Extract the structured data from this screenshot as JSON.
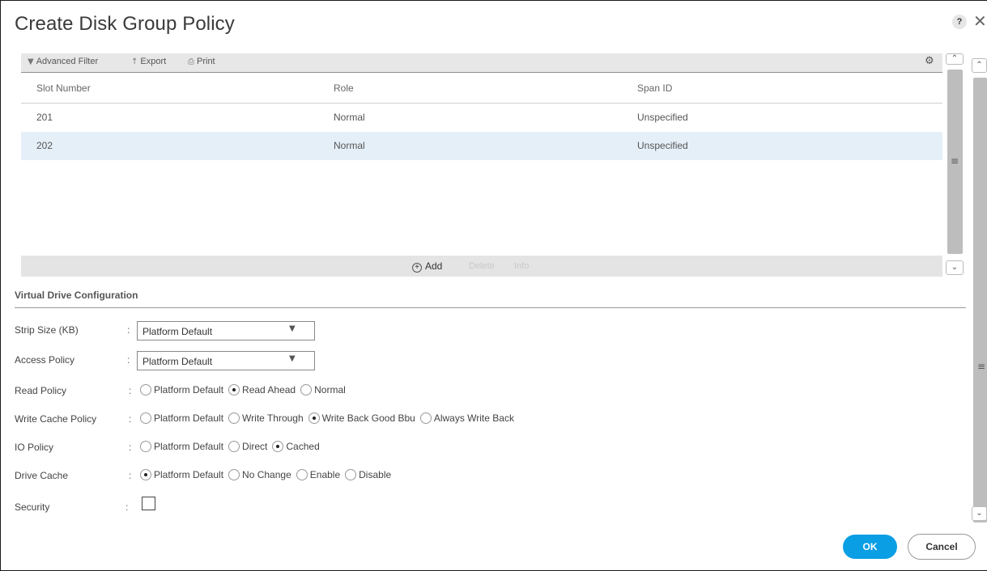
{
  "dialog": {
    "title": "Create Disk Group Policy",
    "help_label": "?",
    "close_label": "✕"
  },
  "toolbar": {
    "advanced_filter": "Advanced Filter",
    "export": "Export",
    "print": "Print"
  },
  "table": {
    "columns": [
      "Slot Number",
      "Role",
      "Span ID"
    ],
    "rows": [
      [
        "201",
        "Normal",
        "Unspecified"
      ],
      [
        "202",
        "Normal",
        "Unspecified"
      ]
    ],
    "selected_row": 2
  },
  "table_actions": {
    "add": "Add",
    "delete": "Delete",
    "info": "Info"
  },
  "section": {
    "title": "Virtual Drive Configuration"
  },
  "form": {
    "strip_size": {
      "label": "Strip Size (KB)",
      "value": "Platform Default"
    },
    "access_policy": {
      "label": "Access Policy",
      "value": "Platform Default"
    },
    "read_policy": {
      "label": "Read Policy",
      "options": [
        "Platform Default",
        "Read Ahead",
        "Normal"
      ],
      "selected": "Read Ahead"
    },
    "write_cache_policy": {
      "label": "Write Cache Policy",
      "options": [
        "Platform Default",
        "Write Through",
        "Write Back Good Bbu",
        "Always Write Back"
      ],
      "selected": "Write Back Good Bbu"
    },
    "io_policy": {
      "label": "IO Policy",
      "options": [
        "Platform Default",
        "Direct",
        "Cached"
      ],
      "selected": "Cached"
    },
    "drive_cache": {
      "label": "Drive Cache",
      "options": [
        "Platform Default",
        "No Change",
        "Enable",
        "Disable"
      ],
      "selected": "Platform Default"
    },
    "security": {
      "label": "Security",
      "checked": false
    }
  },
  "buttons": {
    "ok": "OK",
    "cancel": "Cancel"
  },
  "colors": {
    "primary": "#0a9ee5",
    "selected_row": "#e5eff8"
  }
}
